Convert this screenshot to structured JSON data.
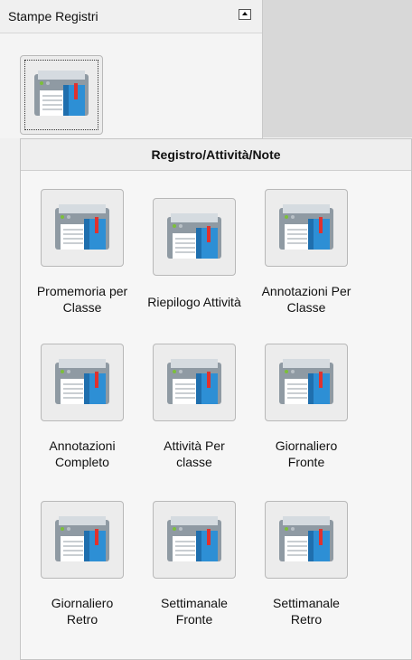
{
  "panel": {
    "title": "Stampe Registri"
  },
  "popup": {
    "title": "Registro/Attività/Note",
    "items": [
      {
        "label": "Promemoria per\nClasse"
      },
      {
        "label": "Riepilogo Attività"
      },
      {
        "label": "Annotazioni Per\nClasse"
      },
      {
        "label": "Annotazioni\nCompleto"
      },
      {
        "label": "Attività Per\nclasse"
      },
      {
        "label": "Giornaliero\nFronte"
      },
      {
        "label": "Giornaliero\nRetro"
      },
      {
        "label": "Settimanale\nFronte"
      },
      {
        "label": "Settimanale\nRetro"
      }
    ]
  },
  "colors": {
    "printer_body": "#8f9aa3",
    "printer_light": "#e7ecef",
    "indicator": "#7cbf3a",
    "book_blue": "#2d8fd5",
    "bookmark_red": "#e0322e"
  },
  "icons": {
    "item_icon": "printer-icon",
    "collapse": "collapse-arrow-icon"
  }
}
